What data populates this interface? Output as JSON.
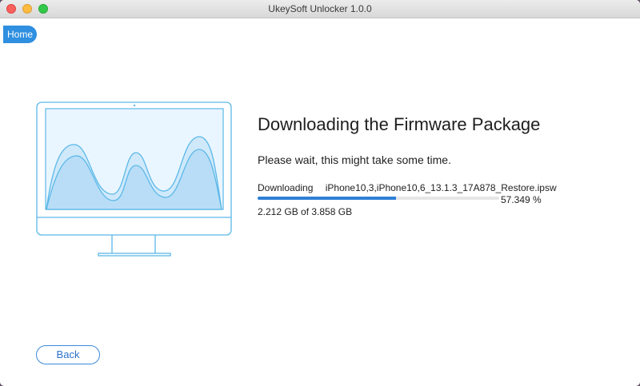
{
  "window": {
    "title": "UkeySoft Unlocker 1.0.0"
  },
  "nav": {
    "home_label": "Home"
  },
  "main": {
    "heading": "Downloading the Firmware Package",
    "subtext": "Please wait, this might take some time.",
    "download_label": "Downloading",
    "file_name": "iPhone10,3,iPhone10,6_13.1.3_17A878_Restore.ipsw",
    "progress_percent": 57.349,
    "progress_text": "57.349 %",
    "size_text": "2.212 GB of 3.858 GB"
  },
  "footer": {
    "back_label": "Back"
  },
  "icons": {
    "illustration": "monitor-waveform-illustration"
  },
  "colors": {
    "accent": "#2f8fe0",
    "progress": "#2f7fd6",
    "illustration_line": "#5bb8e8",
    "illustration_fill": "#dcefff"
  }
}
